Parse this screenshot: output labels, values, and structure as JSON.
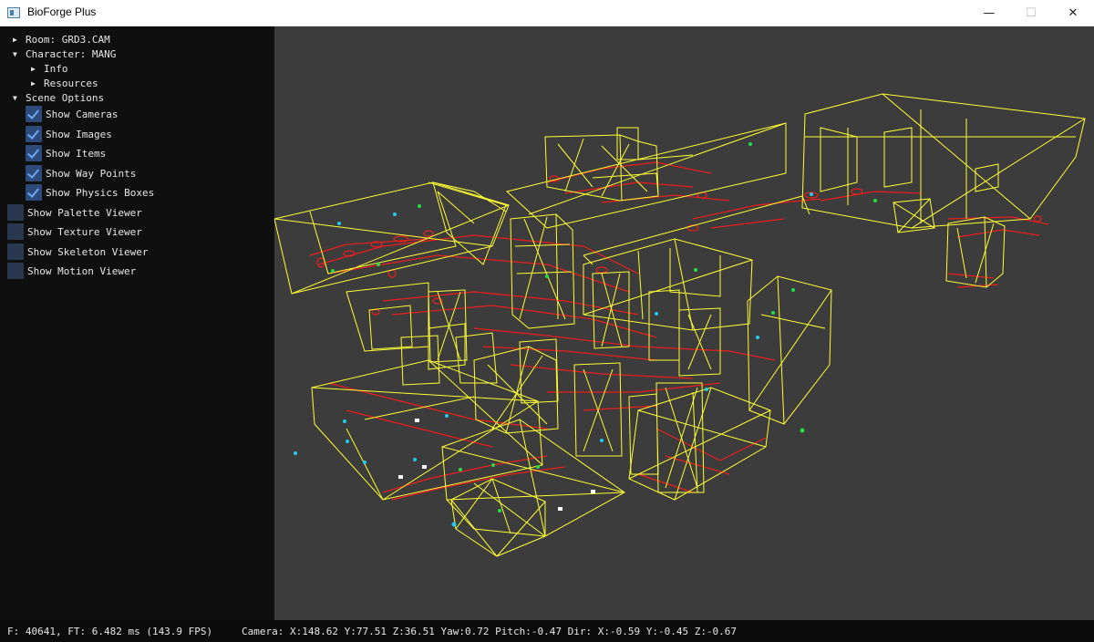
{
  "window": {
    "title": "BioForge Plus",
    "minimize": "—",
    "maximize": "☐",
    "close": "✕"
  },
  "sidebar": {
    "room": "Room: GRD3.CAM",
    "character": "Character: MANG",
    "info": "Info",
    "resources": "Resources",
    "scene_options": "Scene Options",
    "options": [
      {
        "label": "Show Cameras",
        "checked": true
      },
      {
        "label": "Show Images",
        "checked": true
      },
      {
        "label": "Show Items",
        "checked": true
      },
      {
        "label": "Show Way Points",
        "checked": true
      },
      {
        "label": "Show Physics Boxes",
        "checked": true
      },
      {
        "label": "Show Palette Viewer",
        "checked": false
      },
      {
        "label": "Show Texture Viewer",
        "checked": false
      },
      {
        "label": "Show Skeleton Viewer",
        "checked": false
      },
      {
        "label": "Show Motion Viewer",
        "checked": false
      }
    ]
  },
  "status": {
    "frame": "F: 40641, FT: 6.482 ms (143.9 FPS)",
    "camera": "Camera: X:148.62 Y:77.51 Z:36.51 Yaw:0.72 Pitch:-0.47 Dir: X:-0.59 Y:-0.45 Z:-0.67"
  },
  "colors": {
    "viewport_bg": "#3c3c3c",
    "physics_box": "#ffff33",
    "floor_geometry": "#ff1a1a",
    "waypoint_green": "#22dd44",
    "camera_cyan": "#22ccee",
    "item_white": "#ffffff"
  }
}
